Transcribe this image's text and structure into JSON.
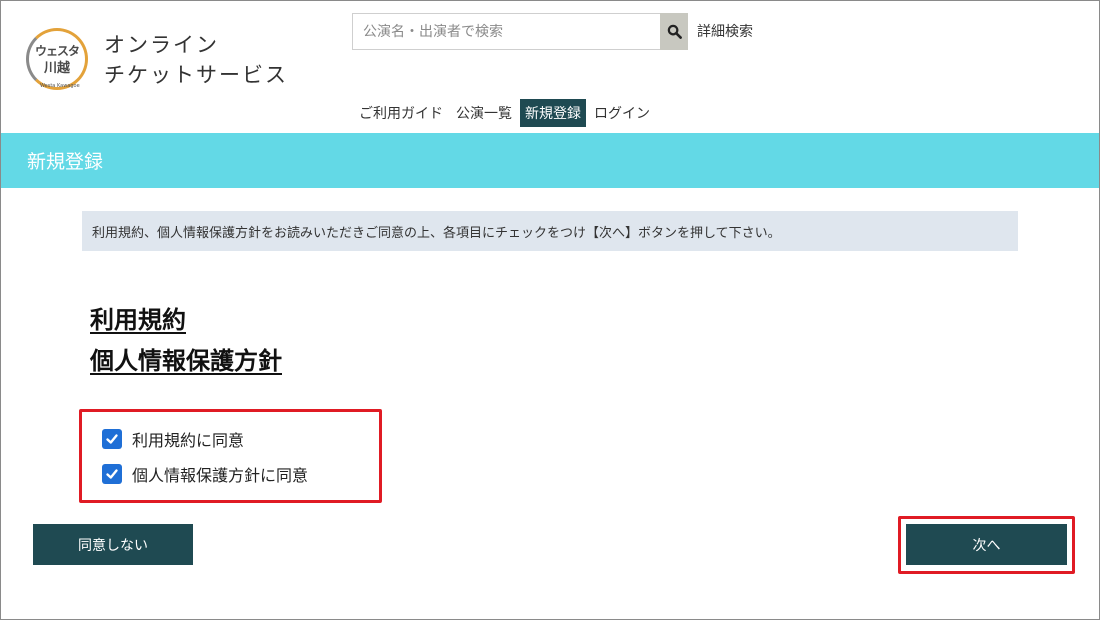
{
  "header": {
    "logo_text_line1": "ウェスタ",
    "logo_text_line2": "川越",
    "logo_sub": "Westa Kawagoe",
    "title_line1": "オンライン",
    "title_line2": "チケットサービス",
    "search": {
      "placeholder": "公演名・出演者で検索",
      "value": ""
    },
    "detail_search_label": "詳細検索"
  },
  "nav": {
    "items": [
      {
        "label": "ご利用ガイド",
        "active": false
      },
      {
        "label": "公演一覧",
        "active": false
      },
      {
        "label": "新規登録",
        "active": true
      },
      {
        "label": "ログイン",
        "active": false
      }
    ]
  },
  "page": {
    "heading": "新規登録",
    "notice": "利用規約、個人情報保護方針をお読みいただきご同意の上、各項目にチェックをつけ【次へ】ボタンを押して下さい。",
    "links": {
      "terms": "利用規約",
      "privacy": "個人情報保護方針"
    },
    "checks": {
      "terms_label": "利用規約に同意",
      "privacy_label": "個人情報保護方針に同意"
    },
    "buttons": {
      "disagree": "同意しない",
      "next": "次へ"
    }
  },
  "colors": {
    "band": "#63d9e6",
    "dark_button": "#1f4a52",
    "checkbox": "#1f6fd6",
    "highlight": "#e01b24",
    "notice_bg": "#dfe6ee"
  }
}
